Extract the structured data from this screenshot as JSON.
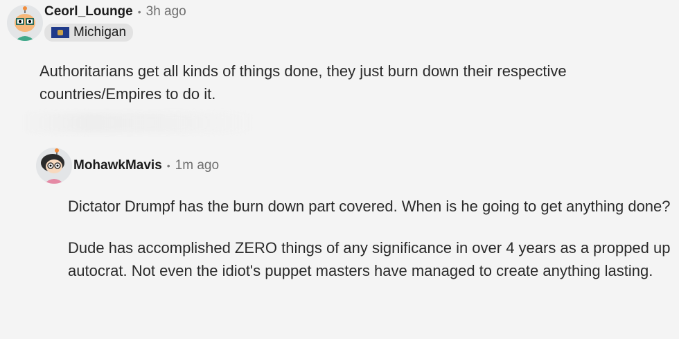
{
  "comments": [
    {
      "username": "Ceorl_Lounge",
      "separator": "•",
      "time": "3h ago",
      "flair": "Michigan",
      "paragraphs": [
        "Authoritarians get all kinds of things done, they just burn down their respective countries/Empires to do it."
      ]
    },
    {
      "username": "MohawkMavis",
      "separator": "•",
      "time": "1m ago",
      "paragraphs": [
        "Dictator Drumpf has the burn down part covered. When is he going to get anything done?",
        "Dude has accomplished ZERO things of any significance in over 4 years as a propped up autocrat. Not even the idiot's puppet masters have managed to create anything lasting."
      ]
    }
  ],
  "colors": {
    "background": "#f4f4f4",
    "flair_bg": "#e2e2e2",
    "meta_text": "#6f6f6f"
  }
}
